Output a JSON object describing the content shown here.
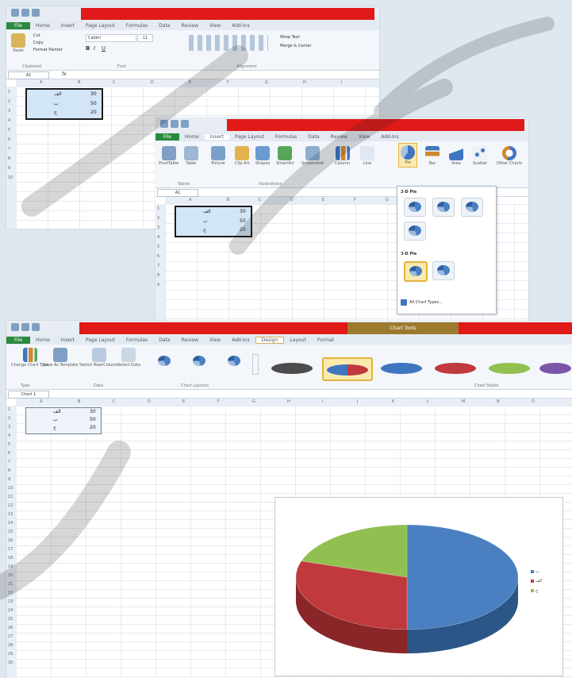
{
  "colors": {
    "titlebar_red": "#e01919",
    "file_tab": "#2a8a3d",
    "chart_tools_tab": "#9b7a2e",
    "pie_blue": "#4a7fc1",
    "pie_red": "#c0393d",
    "pie_green": "#92c050"
  },
  "window1": {
    "tabs": [
      "File",
      "Home",
      "Insert",
      "Page Layout",
      "Formulas",
      "Data",
      "Review",
      "View",
      "Add-Ins"
    ],
    "ribbon": {
      "paste": "Paste",
      "cut": "Cut",
      "copy": "Copy",
      "format_painter": "Format Painter",
      "font_name": "Calibri",
      "font_size": "11",
      "wrap_text": "Wrap Text",
      "merge_center": "Merge & Center",
      "group_clipboard": "Clipboard",
      "group_font": "Font",
      "group_alignment": "Alignment"
    },
    "namebox": "A1",
    "formula_icon": "fx",
    "columns": [
      "A",
      "B",
      "C",
      "D",
      "E",
      "F",
      "G",
      "H",
      "I"
    ],
    "rows": [
      "1",
      "2",
      "3",
      "4",
      "5",
      "6",
      "7",
      "8",
      "9",
      "10"
    ],
    "cells": [
      {
        "label": "الف",
        "value": "30"
      },
      {
        "label": "ب",
        "value": "50"
      },
      {
        "label": "ج",
        "value": "20"
      }
    ]
  },
  "window2": {
    "tabs": [
      "File",
      "Home",
      "Insert",
      "Page Layout",
      "Formulas",
      "Data",
      "Review",
      "View",
      "Add-Ins"
    ],
    "ribbon_buttons": [
      "PivotTable",
      "Table",
      "Picture",
      "Clip Art",
      "Shapes",
      "SmartArt",
      "Screenshot",
      "Column",
      "Line",
      "Pie",
      "Bar",
      "Area",
      "Scatter",
      "Other Charts"
    ],
    "group_tables": "Tables",
    "group_illustrations": "Illustrations",
    "namebox": "A1",
    "columns": [
      "A",
      "B",
      "C",
      "D",
      "E",
      "F",
      "G",
      "H",
      "I"
    ],
    "rows": [
      "1",
      "2",
      "3",
      "4",
      "5",
      "6",
      "7",
      "8",
      "9"
    ],
    "dropdown": {
      "section_2d": "2-D Pie",
      "section_3d": "3-D Pie",
      "all_chart_types": "All Chart Types..."
    }
  },
  "window3": {
    "context_tab": "Chart Tools",
    "tabs": [
      "File",
      "Home",
      "Insert",
      "Page Layout",
      "Formulas",
      "Data",
      "Review",
      "View",
      "Add-Ins",
      "Design",
      "Layout",
      "Format"
    ],
    "ribbon_buttons": [
      "Change Chart Type",
      "Save As Template",
      "Switch Row/Column",
      "Select Data"
    ],
    "group_type": "Type",
    "group_data": "Data",
    "group_layouts": "Chart Layouts",
    "group_styles": "Chart Styles",
    "namebox": "Chart 1",
    "columns": [
      "A",
      "B",
      "C",
      "D",
      "E",
      "F",
      "G",
      "H",
      "I",
      "J",
      "K",
      "L",
      "M",
      "N",
      "O"
    ],
    "rows": [
      "1",
      "2",
      "3",
      "4",
      "5",
      "6",
      "7",
      "8",
      "9",
      "10",
      "11",
      "12",
      "13",
      "14",
      "15",
      "16",
      "17",
      "18",
      "19",
      "20",
      "21",
      "22",
      "23",
      "24",
      "25",
      "26",
      "27",
      "28",
      "29",
      "30"
    ]
  },
  "chart_data": {
    "type": "pie",
    "style": "3-D",
    "categories": [
      "الف",
      "ب",
      "ج"
    ],
    "values": [
      30,
      50,
      20
    ],
    "legend_position": "right"
  }
}
